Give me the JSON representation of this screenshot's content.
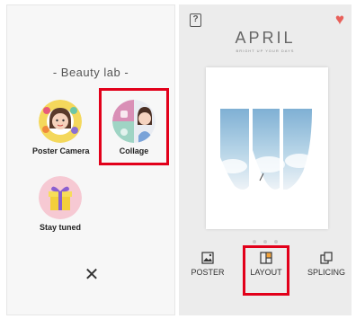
{
  "beauty_lab": {
    "title": "- Beauty lab -",
    "tools": [
      {
        "label": "Poster Camera"
      },
      {
        "label": "Collage"
      },
      {
        "label": "Stay tuned"
      }
    ],
    "close_label": "✕"
  },
  "april": {
    "brand": "APRIL",
    "tagline": "BRIGHT UP YOUR DAYS",
    "help_label": "?",
    "favorite_label": "♥",
    "modes": [
      {
        "label": "POSTER"
      },
      {
        "label": "LAYOUT"
      },
      {
        "label": "SPLICING"
      }
    ]
  },
  "colors": {
    "highlight": "#e2001a",
    "heart": "#e8605a",
    "sky": "#9cc3dc"
  }
}
